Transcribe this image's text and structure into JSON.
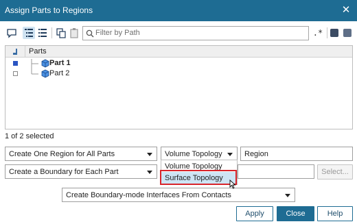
{
  "window": {
    "title": "Assign Parts to Regions",
    "close_glyph": "✕"
  },
  "toolbar": {
    "filter_placeholder": "Filter by Path",
    "regex_label": ".*",
    "icons": [
      "comment-icon",
      "tree-view-icon",
      "list-view-icon",
      "copy-icon",
      "paste-icon",
      "search-icon",
      "filter-on-icon",
      "filter-off-icon"
    ]
  },
  "tree": {
    "column_header": "Parts",
    "items": [
      {
        "label": "Part 1",
        "selected": true,
        "bold": true
      },
      {
        "label": "Part 2",
        "selected": false,
        "bold": false
      }
    ]
  },
  "status": {
    "selection_text": "1 of 2 selected"
  },
  "options": {
    "region_mode": "Create One Region for All Parts",
    "topology": "Volume Topology",
    "region_name": "Region",
    "boundary_mode": "Create a Boundary for Each Part",
    "select_button": "Select...",
    "interface_mode": "Create Boundary-mode Interfaces From Contacts"
  },
  "topology_dropdown": {
    "options": [
      "Volume Topology",
      "Surface Topology"
    ],
    "hovered": "Surface Topology"
  },
  "buttons": {
    "apply": "Apply",
    "close": "Close",
    "help": "Help"
  },
  "colors": {
    "accent": "#1e6c93",
    "highlight": "#d8232a",
    "hover": "#cde4f4"
  }
}
